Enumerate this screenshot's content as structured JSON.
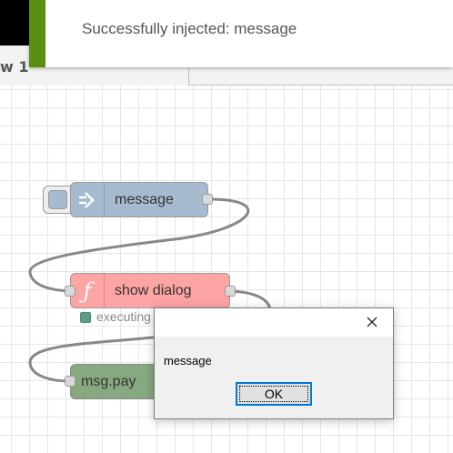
{
  "notification": {
    "text": "Successfully injected: message"
  },
  "tab": {
    "label": "w 1"
  },
  "nodes": {
    "inject": {
      "label": "message"
    },
    "function": {
      "label": "show dialog",
      "status": "executing"
    },
    "debug": {
      "label": "msg.pay"
    }
  },
  "dialog": {
    "message": "message",
    "ok_label": "OK"
  },
  "colors": {
    "inject_node": "#a6bbcf",
    "function_node": "#fda4a4",
    "debug_node": "#87a980",
    "notification_accent": "#5a8f10",
    "status_dot": "#5a9e84"
  },
  "icons": {
    "inject": "arrow-in-icon",
    "function": "function-icon",
    "close": "close-icon"
  }
}
